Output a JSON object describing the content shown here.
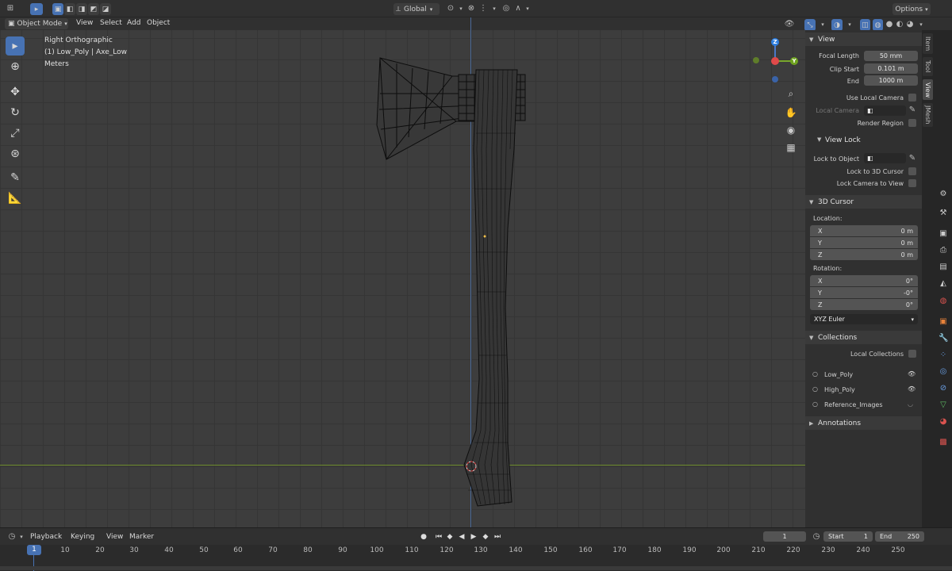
{
  "topbar": {
    "orientation_label": "Global",
    "options_label": "Options"
  },
  "viewport_header": {
    "mode_label": "Object Mode",
    "menu": [
      "View",
      "Select",
      "Add",
      "Object"
    ]
  },
  "overlay": {
    "view_name": "Right Orthographic",
    "object_info": "(1) Low_Poly | Axe_Low",
    "units": "Meters"
  },
  "gizmo": {
    "z": "Z",
    "y": "Y"
  },
  "npanel": {
    "tabs": [
      "Item",
      "Tool",
      "View",
      "JMesh"
    ],
    "active_tab": "View",
    "view": {
      "title": "View",
      "focal_length_label": "Focal Length",
      "focal_length": "50 mm",
      "clip_start_label": "Clip Start",
      "clip_start": "0.101 m",
      "end_label": "End",
      "end": "1000 m",
      "use_local_camera": "Use Local Camera",
      "local_camera": "Local Camera",
      "render_region": "Render Region"
    },
    "view_lock": {
      "title": "View Lock",
      "lock_to_object": "Lock to Object",
      "lock_to_3d_cursor": "Lock to 3D Cursor",
      "lock_camera_to_view": "Lock Camera to View"
    },
    "cursor": {
      "title": "3D Cursor",
      "location_label": "Location:",
      "location": [
        {
          "axis": "X",
          "value": "0 m"
        },
        {
          "axis": "Y",
          "value": "0 m"
        },
        {
          "axis": "Z",
          "value": "0 m"
        }
      ],
      "rotation_label": "Rotation:",
      "rotation": [
        {
          "axis": "X",
          "value": "0°"
        },
        {
          "axis": "Y",
          "value": "-0°"
        },
        {
          "axis": "Z",
          "value": "0°"
        }
      ],
      "rotation_mode": "XYZ Euler"
    },
    "collections": {
      "title": "Collections",
      "local_collections": "Local Collections",
      "items": [
        "Low_Poly",
        "High_Poly",
        "Reference_Images"
      ]
    },
    "annotations": {
      "title": "Annotations"
    }
  },
  "timeline": {
    "menu": [
      "Playback",
      "Keying",
      "View",
      "Marker"
    ],
    "current_frame": "1",
    "start_label": "Start",
    "start": "1",
    "end_label": "End",
    "end": "250",
    "ticks": [
      "10",
      "20",
      "30",
      "40",
      "50",
      "60",
      "70",
      "80",
      "90",
      "100",
      "110",
      "120",
      "130",
      "140",
      "150",
      "160",
      "170",
      "180",
      "190",
      "200",
      "210",
      "220",
      "230",
      "240",
      "250"
    ],
    "playhead": "1"
  }
}
